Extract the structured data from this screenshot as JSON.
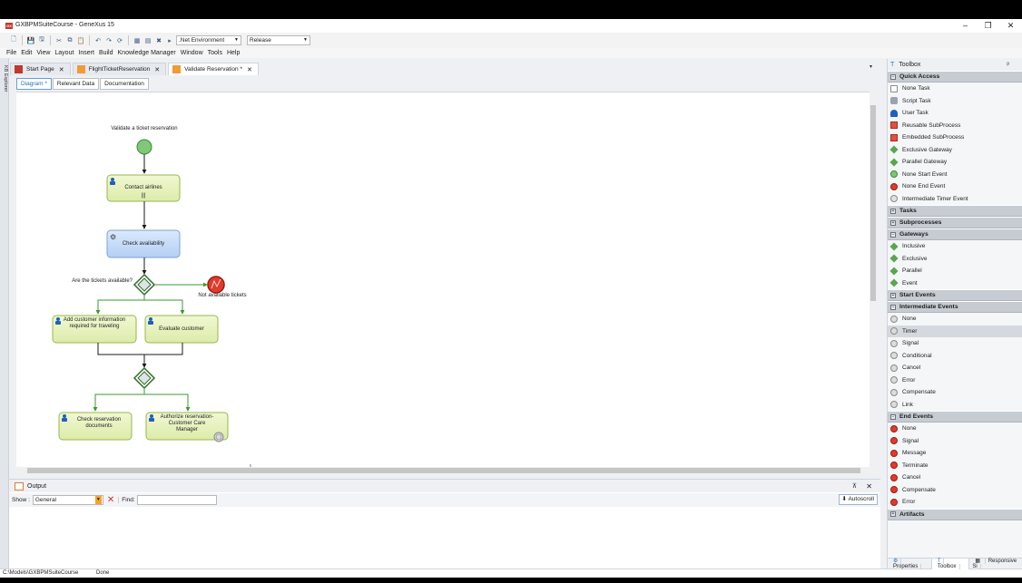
{
  "window": {
    "title": "GXBPMSuiteCourse - GeneXus 15",
    "logo": "GX",
    "controls": [
      "–",
      "❐",
      "✕"
    ]
  },
  "toolbar": {
    "environment": ".Net Environment",
    "configuration": "Release"
  },
  "menu": [
    "File",
    "Edit",
    "View",
    "Layout",
    "Insert",
    "Build",
    "Knowledge Manager",
    "Window",
    "Tools",
    "Help"
  ],
  "left_strip": {
    "kb_explorer": "KB Explorer"
  },
  "doc_tabs": [
    {
      "label": "Start Page"
    },
    {
      "label": "FlightTicketReservation"
    },
    {
      "label": "Validate Reservation *"
    }
  ],
  "sub_tabs": [
    "Diagram *",
    "Relevant Data",
    "Documentation"
  ],
  "diagram": {
    "process_title": "Validate a ticket reservation",
    "tasks": {
      "contact": "Contact airlines",
      "contact_marker": "|||",
      "check": "Check availability",
      "add_customer": "Add customer information required for traveling",
      "evaluate": "Evaluate customer",
      "check_docs": "Check reservation documents",
      "authorize": "Authorize reservation- Customer Care Manager"
    },
    "gateway_label": "Are the tickets available?",
    "end_label": "Not available tickets"
  },
  "output": {
    "title": "Output",
    "show_label": "Show :",
    "show_value": "General",
    "find_label": "Find:",
    "autoscroll": "Autoscroll",
    "pin": "⊼",
    "close": "✕"
  },
  "status": {
    "path": "C:\\Models\\GXBPMSuiteCourse",
    "state": "Done"
  },
  "toolbox": {
    "title": "Toolbox",
    "pin": "ᵖ",
    "sections": [
      {
        "label": "Quick Access",
        "expanded": true,
        "items": [
          {
            "label": "None Task",
            "icon": "none-task"
          },
          {
            "label": "Script Task",
            "icon": "script-task"
          },
          {
            "label": "User Task",
            "icon": "user-task"
          },
          {
            "label": "Reusable SubProcess",
            "icon": "reusable-subprocess"
          },
          {
            "label": "Embedded SubProcess",
            "icon": "embedded-subprocess"
          },
          {
            "label": "Exclusive Gateway",
            "icon": "exclusive-gateway"
          },
          {
            "label": "Parallel Gateway",
            "icon": "parallel-gateway"
          },
          {
            "label": "None Start Event",
            "icon": "start-event"
          },
          {
            "label": "None End Event",
            "icon": "end-event"
          },
          {
            "label": "Intermediate Timer Event",
            "icon": "timer-event"
          }
        ]
      },
      {
        "label": "Tasks",
        "expanded": false,
        "items": []
      },
      {
        "label": "Subprocesses",
        "expanded": false,
        "items": []
      },
      {
        "label": "Gateways",
        "expanded": true,
        "items": [
          {
            "label": "Inclusive",
            "icon": "gateway"
          },
          {
            "label": "Exclusive",
            "icon": "gateway"
          },
          {
            "label": "Parallel",
            "icon": "gateway"
          },
          {
            "label": "Event",
            "icon": "gateway"
          }
        ]
      },
      {
        "label": "Start Events",
        "expanded": false,
        "items": []
      },
      {
        "label": "Intermediate Events",
        "expanded": true,
        "items": [
          {
            "label": "None",
            "icon": "intermediate-event"
          },
          {
            "label": "Timer",
            "icon": "intermediate-event",
            "selected": true
          },
          {
            "label": "Signal",
            "icon": "intermediate-event"
          },
          {
            "label": "Conditional",
            "icon": "intermediate-event"
          },
          {
            "label": "Cancel",
            "icon": "intermediate-event"
          },
          {
            "label": "Error",
            "icon": "intermediate-event"
          },
          {
            "label": "Compensate",
            "icon": "intermediate-event"
          },
          {
            "label": "Link",
            "icon": "intermediate-event"
          }
        ]
      },
      {
        "label": "End Events",
        "expanded": true,
        "items": [
          {
            "label": "None",
            "icon": "end-event"
          },
          {
            "label": "Signal",
            "icon": "end-event"
          },
          {
            "label": "Message",
            "icon": "end-event"
          },
          {
            "label": "Terminate",
            "icon": "end-event"
          },
          {
            "label": "Cancel",
            "icon": "end-event"
          },
          {
            "label": "Compensate",
            "icon": "end-event"
          },
          {
            "label": "Error",
            "icon": "end-event"
          }
        ]
      },
      {
        "label": "Artifacts",
        "expanded": false,
        "items": []
      }
    ],
    "footer_tabs": [
      "Properties",
      "Toolbox",
      "Responsive Si"
    ]
  },
  "colors": {
    "task_green": "#e7f2b8",
    "task_blue": "#c6dcf8",
    "flow": "#3a9a2e",
    "start": "#7ec878",
    "end": "#e23b2b"
  }
}
